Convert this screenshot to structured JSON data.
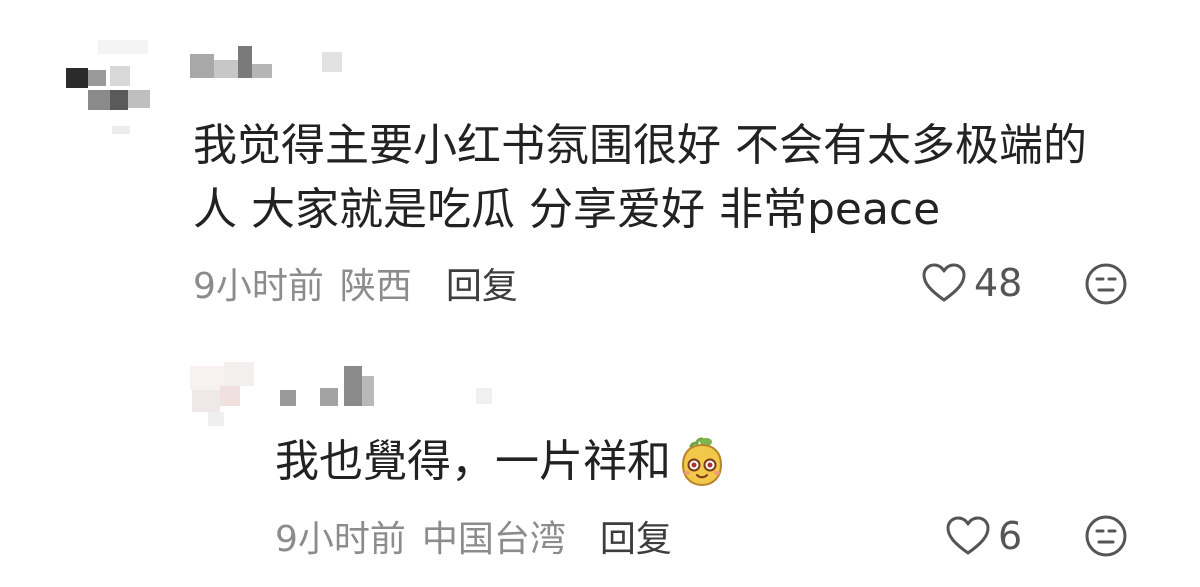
{
  "comments": [
    {
      "text_line1": "我觉得主要小红书氛围很好 不会有太多极端的",
      "text_line2": "人 大家就是吃瓜 分享爱好 非常peace",
      "time": "9小时前",
      "location": "陕西",
      "reply_label": "回复",
      "likes": "48"
    },
    {
      "text_line1": "我也覺得，一片祥和",
      "time": "9小时前",
      "location": "中国台湾",
      "reply_label": "回复",
      "likes": "6"
    }
  ],
  "icons": {
    "like": "heart-outline-icon",
    "reaction": "neutral-face-icon",
    "emoji": "yellow-mascot-emoji"
  },
  "colors": {
    "text_main": "#222222",
    "text_meta": "#8c8c8c",
    "text_reply": "#3d3d3d",
    "icon_stroke": "#555555"
  }
}
